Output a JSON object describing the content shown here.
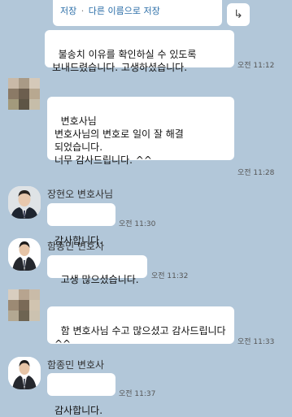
{
  "file_card": {
    "save_label": "저장",
    "separator": "·",
    "save_as_label": "다른 이름으로 저장",
    "share_glyph": "↳"
  },
  "messages": [
    {
      "sender": "",
      "text": "불송치 이유를 확인하실 수 있도록 보내드렸습니다. 고생하셨습니다.",
      "time": "오전 11:12"
    },
    {
      "sender": "",
      "text": "변호사님\n변호사님의 변호로 일이 잘 해결 되었습니다.\n너무 감사드립니다. ^^",
      "time": "오전 11:28"
    },
    {
      "sender": "장현오 변호사님",
      "text": "감사합니다.",
      "time": "오전 11:30"
    },
    {
      "sender": "함종민 변호사",
      "text": "고생 많으셨습니다.",
      "time": "오전 11:32"
    },
    {
      "sender": "",
      "text": "함 변호사님 수고 많으셨고 감사드립니다^^",
      "time": "오전 11:33"
    },
    {
      "sender": "함종민 변호사",
      "text": "감사합니다.",
      "time": "오전 11:37"
    }
  ],
  "colors": {
    "background": "#b2c7d9",
    "bubble": "#ffffff",
    "link": "#2b6ea8"
  },
  "icons": {
    "avatar_blurred": "mosaic-avatar-icon",
    "avatar_lawyer": "person-avatar-icon",
    "share": "share-arrow-icon"
  }
}
